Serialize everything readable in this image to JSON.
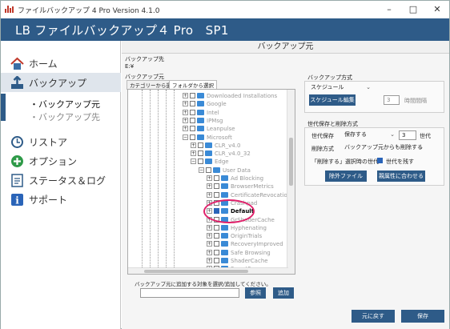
{
  "window": {
    "title": "ファイルバックアップ 4 Pro Version 4.1.0",
    "controls": {
      "minimize": "–",
      "maximize": "□",
      "close": "✕"
    }
  },
  "header": {
    "title": "LB ファイルバックアップ４ Pro　SP1"
  },
  "sidebar": {
    "items": [
      {
        "label": "ホーム",
        "icon": "home-icon"
      },
      {
        "label": "バックアップ",
        "icon": "backup-icon"
      },
      {
        "label": "リストア",
        "icon": "restore-icon"
      },
      {
        "label": "オプション",
        "icon": "options-icon"
      },
      {
        "label": "ステータス＆ログ",
        "icon": "status-log-icon"
      },
      {
        "label": "サポート",
        "icon": "support-icon"
      }
    ],
    "sub_items": [
      "・バックアップ元",
      "・バックアップ先"
    ]
  },
  "content": {
    "title": "バックアップ元",
    "dest_label": "バックアップ先",
    "dest_value": "E:¥",
    "source_label": "バックアップ元",
    "tabs": [
      "カテゴリーから選択",
      "フォルダから選択"
    ],
    "tree": [
      "Downloaded Installations",
      "Google",
      "Intel",
      "IPMsg",
      "Leanpulse",
      "Microsoft",
      "CLR_v4.0",
      "CLR_v4.0_32",
      "Edge",
      "User Data",
      "Ad Blocking",
      "BrowserMetrics",
      "CertificateRevocation",
      "Crashpad",
      "Default",
      "GrShaderCache",
      "Hyphenating",
      "OriginTrials",
      "RecoveryImproved",
      "Safe Browsing",
      "ShaderCache",
      "SmartScreen"
    ],
    "add_hint": "バックアップ元に追加する対象を選択/追加してください。",
    "add_input": "",
    "browse_button": "参照",
    "add_button": "追加"
  },
  "method": {
    "group_title": "バックアップ方式",
    "schedule_value": "スケジュール",
    "edit_schedule_button": "スケジュール編集",
    "interval_value": "3",
    "interval_label": "時間間隔"
  },
  "generation": {
    "group_title": "世代保存と削除方式",
    "save_label": "世代保存",
    "save_value": "保存する",
    "gen_count": "3",
    "gen_unit": "世代",
    "delete_label": "削除方式",
    "delete_value": "バックアップ元からも削除する",
    "keep_label": "「削除する」選択時の世代",
    "keep_checkbox_label": "世代を残す",
    "exclude_button": "除外ファイル",
    "attr_button": "親属性に合わせる"
  },
  "footer": {
    "undo_button": "元に戻す",
    "save_button": "保存"
  },
  "colors": {
    "header": "#2e5b88",
    "accent": "#2a64b8",
    "highlight_ring": "#e0206a"
  }
}
